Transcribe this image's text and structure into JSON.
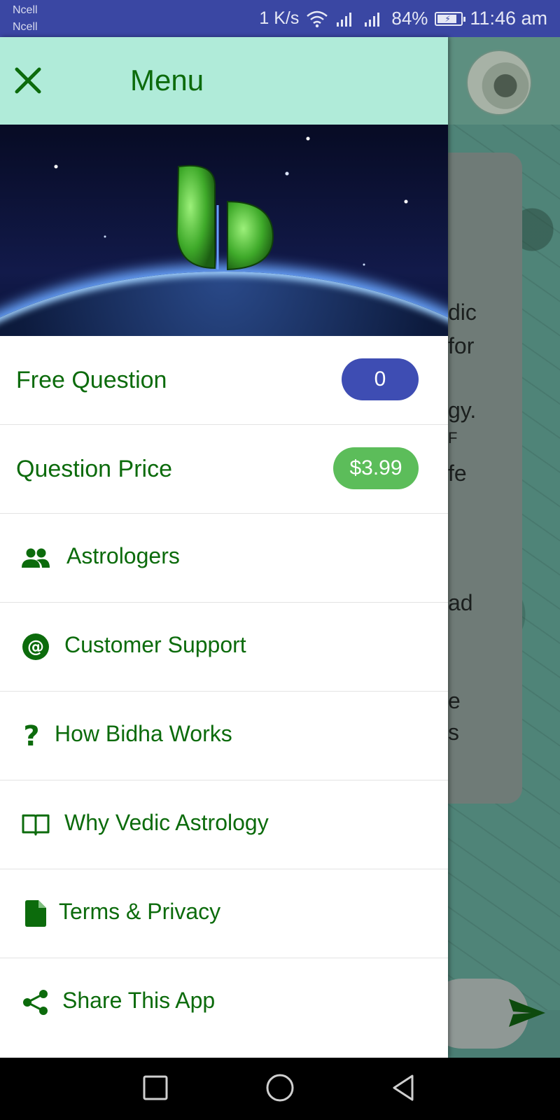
{
  "status_bar": {
    "carrier_1": "Ncell",
    "carrier_2": "Ncell",
    "speed": "1 K/s",
    "battery_percent": "84%",
    "battery_level": 0.84,
    "time": "11:46 am"
  },
  "background_chat": {
    "text_fragments": [
      "dic",
      "for",
      "gy.",
      "F",
      "fe",
      "ad",
      "e",
      "s"
    ]
  },
  "drawer": {
    "close_icon": "close-icon",
    "title": "Menu",
    "info_rows": [
      {
        "label": "Free Question",
        "badge": "0",
        "badge_color": "#3e4db3"
      },
      {
        "label": "Question Price",
        "badge": "$3.99",
        "badge_color": "#5cbd5a"
      }
    ],
    "items": [
      {
        "icon": "people-icon",
        "label": "Astrologers"
      },
      {
        "icon": "at-sign-icon",
        "label": "Customer Support"
      },
      {
        "icon": "question-mark-icon",
        "label": "How Bidha Works"
      },
      {
        "icon": "open-book-icon",
        "label": "Why Vedic Astrology"
      },
      {
        "icon": "document-icon",
        "label": "Terms & Privacy"
      },
      {
        "icon": "share-icon",
        "label": "Share This App"
      }
    ]
  },
  "colors": {
    "status_bar": "#3a47a3",
    "drawer_header": "#b0ebd9",
    "accent_text": "#0c6b0c"
  },
  "nav_bar": {
    "buttons": [
      "recents-icon",
      "home-icon",
      "back-icon"
    ]
  }
}
